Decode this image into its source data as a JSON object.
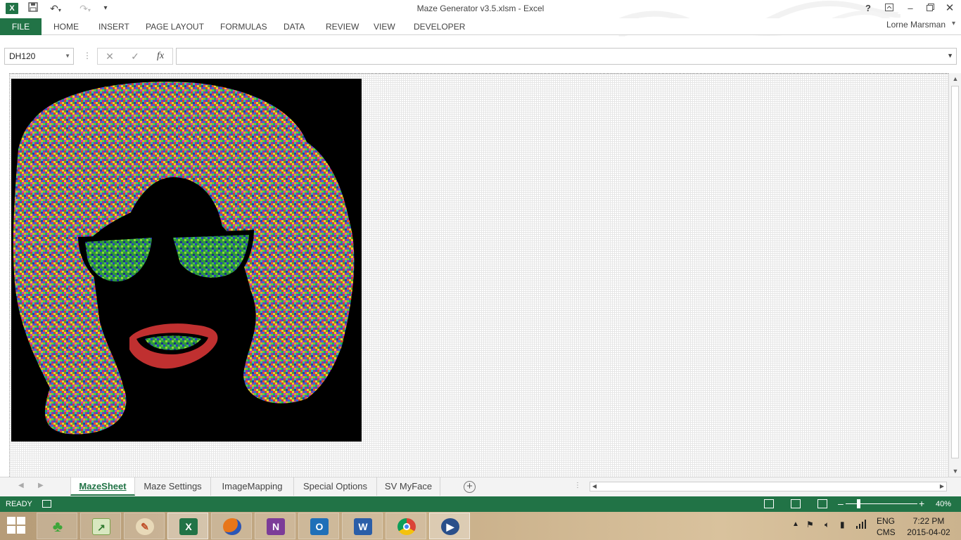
{
  "window": {
    "title": "Maze Generator v3.5.xlsm - Excel",
    "app_icon": "X",
    "help": "?",
    "user": "Lorne Marsman"
  },
  "ribbon": {
    "file": "FILE",
    "tabs": [
      "HOME",
      "INSERT",
      "PAGE LAYOUT",
      "FORMULAS",
      "DATA",
      "REVIEW",
      "VIEW",
      "DEVELOPER"
    ]
  },
  "formula_bar": {
    "name_box": "DH120",
    "function_icon": "fx",
    "formula": ""
  },
  "sheets": {
    "tabs": [
      "MazeSheet",
      "Maze Settings",
      "ImageMapping",
      "Special Options",
      "SV MyFace"
    ],
    "active": "MazeSheet"
  },
  "status": {
    "ready": "READY",
    "zoom_label": "40%",
    "zoom_level_percent": 40
  },
  "taskbar": {
    "lang_line1": "ENG",
    "lang_line2": "CMS",
    "time": "7:22 PM",
    "date": "2015-04-02",
    "apps": [
      "clover-icon",
      "excel-chart-icon",
      "paint-icon",
      "excel-icon",
      "firefox-icon",
      "onenote-icon",
      "outlook-icon",
      "word-icon",
      "chrome-icon",
      "media-icon"
    ]
  },
  "colors": {
    "excel_green": "#217346",
    "maze_background": "#000000"
  }
}
